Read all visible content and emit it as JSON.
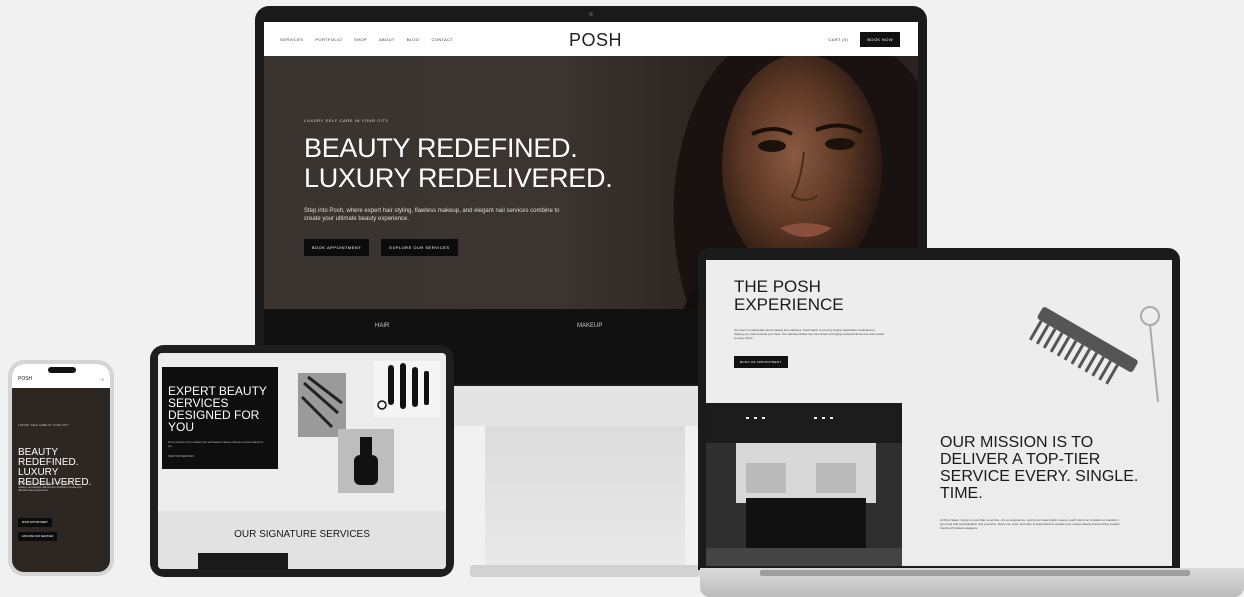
{
  "desktop": {
    "nav": {
      "links": [
        "SERVICES",
        "PORTFOLIO",
        "SHOP",
        "ABOUT",
        "BLOG",
        "CONTACT"
      ],
      "logo": "POSH",
      "cart": "CART (0)",
      "book_now": "BOOK NOW"
    },
    "hero": {
      "eyebrow": "LUXURY SELF CARE IN YOUR CITY",
      "headline_line1": "BEAUTY REDEFINED.",
      "headline_line2": "LUXURY REDELIVERED.",
      "subtext": "Step into Posh, where expert hair styling, flawless makeup, and elegant nail services combine to create your ultimate beauty experience.",
      "button_primary": "BOOK APPOINTMENT",
      "button_secondary": "EXPLORE OUR SERVICES"
    },
    "categories": [
      "HAIR",
      "MAKEUP"
    ]
  },
  "laptop": {
    "title": "THE POSH EXPERIENCE",
    "copy": "Our team is passionate about beauty and wellness. Posh Salon is a luxury beauty destination dedicated to helping you look and feel your best. Our talented artists are committed to bringing exceptional service and results to every client.",
    "button": "BOOK AN APPOINTMENT",
    "mission": "OUR MISSION IS TO DELIVER A TOP-TIER SERVICE EVERY. SINGLE. TIME.",
    "mission_copy": "At Posh Salon, luxury is more than a service—it's an experience. Led by our head stylist, Lauren, each visit is an invitation to transform your look with sophistication and precision. Every cut, color, and style is customized to elevate your unique beauty, harmonizing modern trends with classic elegance."
  },
  "tablet": {
    "title": "EXPERT BEAUTY SERVICES DESIGNED FOR YOU",
    "copy": "From precision cuts to radiant color and flawless makeup, discover services tailored to you.",
    "link": "VIEW OUR SERVICES",
    "section_title": "OUR SIGNATURE SERVICES"
  },
  "phone": {
    "logo": "POSH",
    "icons": "◦ ≡",
    "eyebrow": "LUXURY SELF CARE IN YOUR CITY",
    "headline": "BEAUTY REDEFINED. LUXURY REDELIVERED.",
    "copy": "Step into Posh, where expert hair styling, flawless makeup, and elegant nail services combine to create your ultimate beauty experience.",
    "button_primary": "BOOK APPOINTMENT",
    "button_secondary": "EXPLORE OUR SERVICES"
  }
}
